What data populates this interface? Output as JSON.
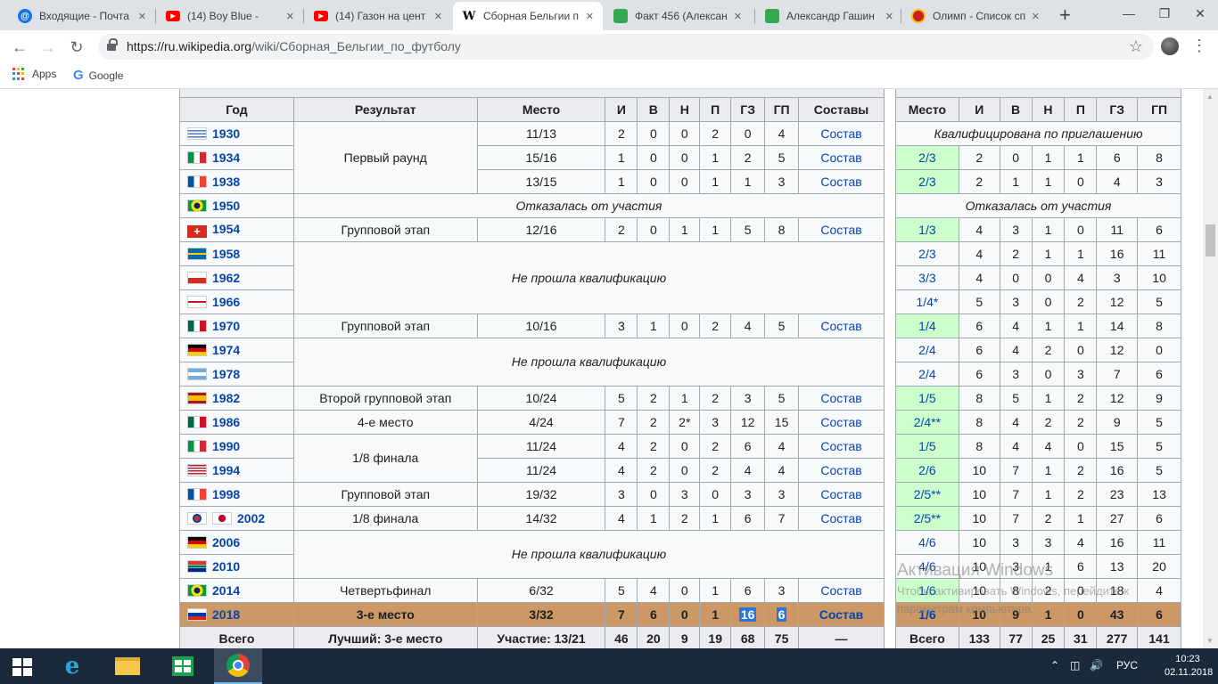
{
  "browser": {
    "tabs": [
      {
        "title": "Входящие - Почта",
        "icon": "mail-icon",
        "color": "#1a73e8"
      },
      {
        "title": "(14) Boy Blue -",
        "icon": "youtube-icon",
        "color": "#ff0000"
      },
      {
        "title": "(14) Газон на цент",
        "icon": "youtube-icon",
        "color": "#ff0000"
      },
      {
        "title": "Сборная Бельгии п",
        "icon": "wikipedia-icon",
        "color": "#000000"
      },
      {
        "title": "Факт 456 (Алексан",
        "icon": "sheets-icon",
        "color": "#34a853"
      },
      {
        "title": "Александр Гашин",
        "icon": "sheets-icon",
        "color": "#34a853"
      },
      {
        "title": "Олимп - Список сп",
        "icon": "olimp-icon",
        "color": "#c5221f"
      }
    ],
    "url_domain": "https://ru.wikipedia.org",
    "url_path": "/wiki/Сборная_Бельгии_по_футболу",
    "bookmarks": [
      {
        "label": "Apps",
        "icon": "apps-grid-icon"
      },
      {
        "label": "Google",
        "icon": "google-icon"
      }
    ]
  },
  "table": {
    "headers": [
      "Год",
      "Результат",
      "Место",
      "И",
      "В",
      "Н",
      "П",
      "ГЗ",
      "ГП",
      "Составы",
      "Место",
      "И",
      "В",
      "Н",
      "П",
      "ГЗ",
      "ГП"
    ],
    "squad_label": "Состав",
    "invited_text": "Квалифицирована по приглашению",
    "withdrew_text": "Отказалась от участия",
    "not_qualified_text": "Не прошла квалификацию",
    "results": {
      "first_round": "Первый раунд",
      "group": "Групповой этап",
      "second_group": "Второй групповой этап",
      "fourth": "4-е место",
      "r16": "1/8 финала",
      "qf": "Четвертьфинал",
      "third": "3-е место"
    },
    "rows": [
      {
        "year": "1930",
        "flag": "uruguay",
        "place": "11/13",
        "stats": [
          "2",
          "0",
          "0",
          "2",
          "0",
          "4"
        ],
        "q_place": "",
        "q_stats": [],
        "q_green": false
      },
      {
        "year": "1934",
        "flag": "italy",
        "place": "15/16",
        "stats": [
          "1",
          "0",
          "0",
          "1",
          "2",
          "5"
        ],
        "q_place": "2/3",
        "q_stats": [
          "2",
          "0",
          "1",
          "1",
          "6",
          "8"
        ],
        "q_green": true
      },
      {
        "year": "1938",
        "flag": "france",
        "place": "13/15",
        "stats": [
          "1",
          "0",
          "0",
          "1",
          "1",
          "3"
        ],
        "q_place": "2/3",
        "q_stats": [
          "2",
          "1",
          "1",
          "0",
          "4",
          "3"
        ],
        "q_green": true
      },
      {
        "year": "1950",
        "flag": "brazil",
        "place": "",
        "stats": [],
        "q_place": "",
        "q_stats": [],
        "q_green": false
      },
      {
        "year": "1954",
        "flag": "switzerland",
        "place": "12/16",
        "stats": [
          "2",
          "0",
          "1",
          "1",
          "5",
          "8"
        ],
        "q_place": "1/3",
        "q_stats": [
          "4",
          "3",
          "1",
          "0",
          "11",
          "6"
        ],
        "q_green": true
      },
      {
        "year": "1958",
        "flag": "sweden",
        "place": "",
        "stats": [],
        "q_place": "2/3",
        "q_stats": [
          "4",
          "2",
          "1",
          "1",
          "16",
          "11"
        ],
        "q_green": false
      },
      {
        "year": "1962",
        "flag": "chile",
        "place": "",
        "stats": [],
        "q_place": "3/3",
        "q_stats": [
          "4",
          "0",
          "0",
          "4",
          "3",
          "10"
        ],
        "q_green": false
      },
      {
        "year": "1966",
        "flag": "england",
        "place": "",
        "stats": [],
        "q_place": "1/4*",
        "q_stats": [
          "5",
          "3",
          "0",
          "2",
          "12",
          "5"
        ],
        "q_green": false
      },
      {
        "year": "1970",
        "flag": "mexico",
        "place": "10/16",
        "stats": [
          "3",
          "1",
          "0",
          "2",
          "4",
          "5"
        ],
        "q_place": "1/4",
        "q_stats": [
          "6",
          "4",
          "1",
          "1",
          "14",
          "8"
        ],
        "q_green": true
      },
      {
        "year": "1974",
        "flag": "germany",
        "place": "",
        "stats": [],
        "q_place": "2/4",
        "q_stats": [
          "6",
          "4",
          "2",
          "0",
          "12",
          "0"
        ],
        "q_green": false
      },
      {
        "year": "1978",
        "flag": "argentina",
        "place": "",
        "stats": [],
        "q_place": "2/4",
        "q_stats": [
          "6",
          "3",
          "0",
          "3",
          "7",
          "6"
        ],
        "q_green": false
      },
      {
        "year": "1982",
        "flag": "spain",
        "place": "10/24",
        "stats": [
          "5",
          "2",
          "1",
          "2",
          "3",
          "5"
        ],
        "q_place": "1/5",
        "q_stats": [
          "8",
          "5",
          "1",
          "2",
          "12",
          "9"
        ],
        "q_green": true
      },
      {
        "year": "1986",
        "flag": "mexico",
        "place": "4/24",
        "stats": [
          "7",
          "2",
          "2*",
          "3",
          "12",
          "15"
        ],
        "q_place": "2/4**",
        "q_stats": [
          "8",
          "4",
          "2",
          "2",
          "9",
          "5"
        ],
        "q_green": true
      },
      {
        "year": "1990",
        "flag": "italy",
        "place": "11/24",
        "stats": [
          "4",
          "2",
          "0",
          "2",
          "6",
          "4"
        ],
        "q_place": "1/5",
        "q_stats": [
          "8",
          "4",
          "4",
          "0",
          "15",
          "5"
        ],
        "q_green": true
      },
      {
        "year": "1994",
        "flag": "usa",
        "place": "11/24",
        "stats": [
          "4",
          "2",
          "0",
          "2",
          "4",
          "4"
        ],
        "q_place": "2/6",
        "q_stats": [
          "10",
          "7",
          "1",
          "2",
          "16",
          "5"
        ],
        "q_green": true
      },
      {
        "year": "1998",
        "flag": "france",
        "place": "19/32",
        "stats": [
          "3",
          "0",
          "3",
          "0",
          "3",
          "3"
        ],
        "q_place": "2/5**",
        "q_stats": [
          "10",
          "7",
          "1",
          "2",
          "23",
          "13"
        ],
        "q_green": true
      },
      {
        "year": "2002",
        "flag": "korea-japan",
        "place": "14/32",
        "stats": [
          "4",
          "1",
          "2",
          "1",
          "6",
          "7"
        ],
        "q_place": "2/5**",
        "q_stats": [
          "10",
          "7",
          "2",
          "1",
          "27",
          "6"
        ],
        "q_green": true
      },
      {
        "year": "2006",
        "flag": "germany",
        "place": "",
        "stats": [],
        "q_place": "4/6",
        "q_stats": [
          "10",
          "3",
          "3",
          "4",
          "16",
          "11"
        ],
        "q_green": false
      },
      {
        "year": "2010",
        "flag": "south-africa",
        "place": "",
        "stats": [],
        "q_place": "4/6",
        "q_stats": [
          "10",
          "3",
          "1",
          "6",
          "13",
          "20"
        ],
        "q_green": false
      },
      {
        "year": "2014",
        "flag": "brazil",
        "place": "6/32",
        "stats": [
          "5",
          "4",
          "0",
          "1",
          "6",
          "3"
        ],
        "q_place": "1/6",
        "q_stats": [
          "10",
          "8",
          "2",
          "0",
          "18",
          "4"
        ],
        "q_green": true
      },
      {
        "year": "2018",
        "flag": "russia",
        "place": "3/32",
        "stats": [
          "7",
          "6",
          "0",
          "1",
          "16",
          "6"
        ],
        "q_place": "1/6",
        "q_stats": [
          "10",
          "9",
          "1",
          "0",
          "43",
          "6"
        ],
        "q_green": true
      }
    ],
    "total": {
      "label": "Всего",
      "best": "Лучший: 3-е место",
      "participation": "Участие: 13/21",
      "stats": [
        "46",
        "20",
        "9",
        "19",
        "68",
        "75"
      ],
      "squad": "—",
      "q_label": "Всего",
      "q_stats": [
        "133",
        "77",
        "25",
        "31",
        "277",
        "141"
      ]
    }
  },
  "watermark": {
    "title": "Активация Windows",
    "subtitle": "Чтобы активировать Windows, перейдите к параметрам компьютера."
  },
  "taskbar": {
    "language": "РУС",
    "time": "10:23",
    "date": "02.11.2018"
  }
}
